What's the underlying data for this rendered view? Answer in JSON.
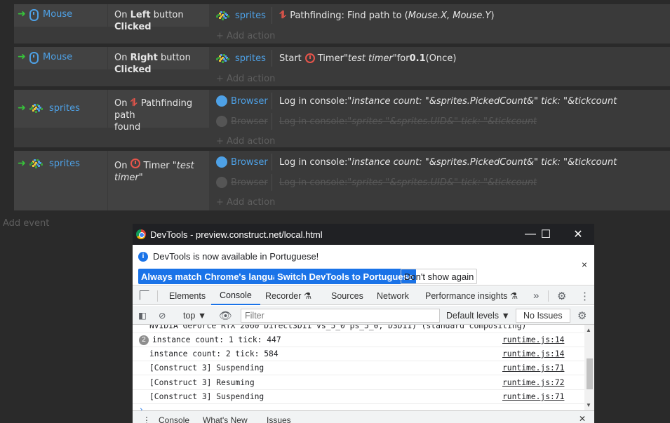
{
  "events": [
    {
      "condition": {
        "object": "Mouse",
        "parts": [
          "On ",
          "Left",
          " button ",
          "Clicked"
        ]
      },
      "actions": [
        {
          "object": "sprites",
          "text": "Pathfinding: Find path to (",
          "italic": "Mouse.X, Mouse.Y",
          "text_after": ")",
          "disabled": false
        }
      ],
      "add_action": "+ Add action"
    },
    {
      "condition": {
        "object": "Mouse",
        "parts": [
          "On ",
          "Right",
          " button ",
          "Clicked"
        ]
      },
      "actions": [
        {
          "object": "sprites",
          "pre": "Start",
          "mid": "Timer ",
          "italic": "\"test timer\"",
          "post": " for ",
          "bold": "0.1",
          "tail": " (Once)",
          "disabled": false
        }
      ],
      "add_action": "+ Add action"
    },
    {
      "condition": {
        "object": "sprites",
        "line1": "Pathfinding path",
        "line2": "found",
        "prefix": "On"
      },
      "actions": [
        {
          "object": "Browser",
          "text": "Log in console: ",
          "italic": "\"instance count: \"&sprites.PickedCount&\" tick: \"&tickcount",
          "disabled": false
        },
        {
          "object": "Browser",
          "text": "Log in console: ",
          "italic": "\"sprites \"&sprites.UID&\" tick: \"&tickcount",
          "disabled": true
        }
      ],
      "add_action": "+ Add action"
    },
    {
      "condition": {
        "object": "sprites",
        "prefix": "On",
        "mid": "Timer ",
        "italic": "\"test timer\""
      },
      "actions": [
        {
          "object": "Browser",
          "text": "Log in console: ",
          "italic": "\"instance count: \"&sprites.PickedCount&\" tick: \"&tickcount",
          "disabled": false
        },
        {
          "object": "Browser",
          "text": "Log in console: ",
          "italic": "\"sprites \"&sprites.UID&\" tick: \"&tickcount",
          "disabled": true
        }
      ],
      "add_action": "+ Add action"
    }
  ],
  "add_event": "Add event",
  "devtools": {
    "title": "DevTools - preview.construct.net/local.html",
    "window_buttons": {
      "minimize": "—",
      "maximize": "☐",
      "close": "✕"
    },
    "infobar": {
      "message": "DevTools is now available in Portuguese!",
      "btn_match": "Always match Chrome's language",
      "btn_switch": "Switch DevTools to Portuguese",
      "btn_dont": "Don't show again",
      "close": "×"
    },
    "tabs": [
      "Elements",
      "Console",
      "Recorder ⚗",
      "Sources",
      "Network",
      "Performance insights ⚗"
    ],
    "active_tab": "Console",
    "more_tabs": "»",
    "toolbar": {
      "context": "top ▼",
      "filter_placeholder": "Filter",
      "levels": "Default levels ▼",
      "issues": "No Issues"
    },
    "console_rows": [
      {
        "msg": "NVIDIA GeForce RTX 2060 Direct3D11 vs_5_0 ps_5_0, D3D11) (standard compositing)",
        "src": ""
      },
      {
        "count": "2",
        "msg": "instance count: 1 tick: 447",
        "src": "runtime.js:14"
      },
      {
        "msg": "instance count: 2 tick: 584",
        "src": "runtime.js:14"
      },
      {
        "msg": "[Construct 3] Suspending",
        "src": "runtime.js:71"
      },
      {
        "msg": "[Construct 3] Resuming",
        "src": "runtime.js:72"
      },
      {
        "msg": "[Construct 3] Suspending",
        "src": "runtime.js:71"
      }
    ],
    "drawer_tabs": [
      "Console",
      "What's New",
      "Issues"
    ],
    "drawer_close": "✕"
  }
}
